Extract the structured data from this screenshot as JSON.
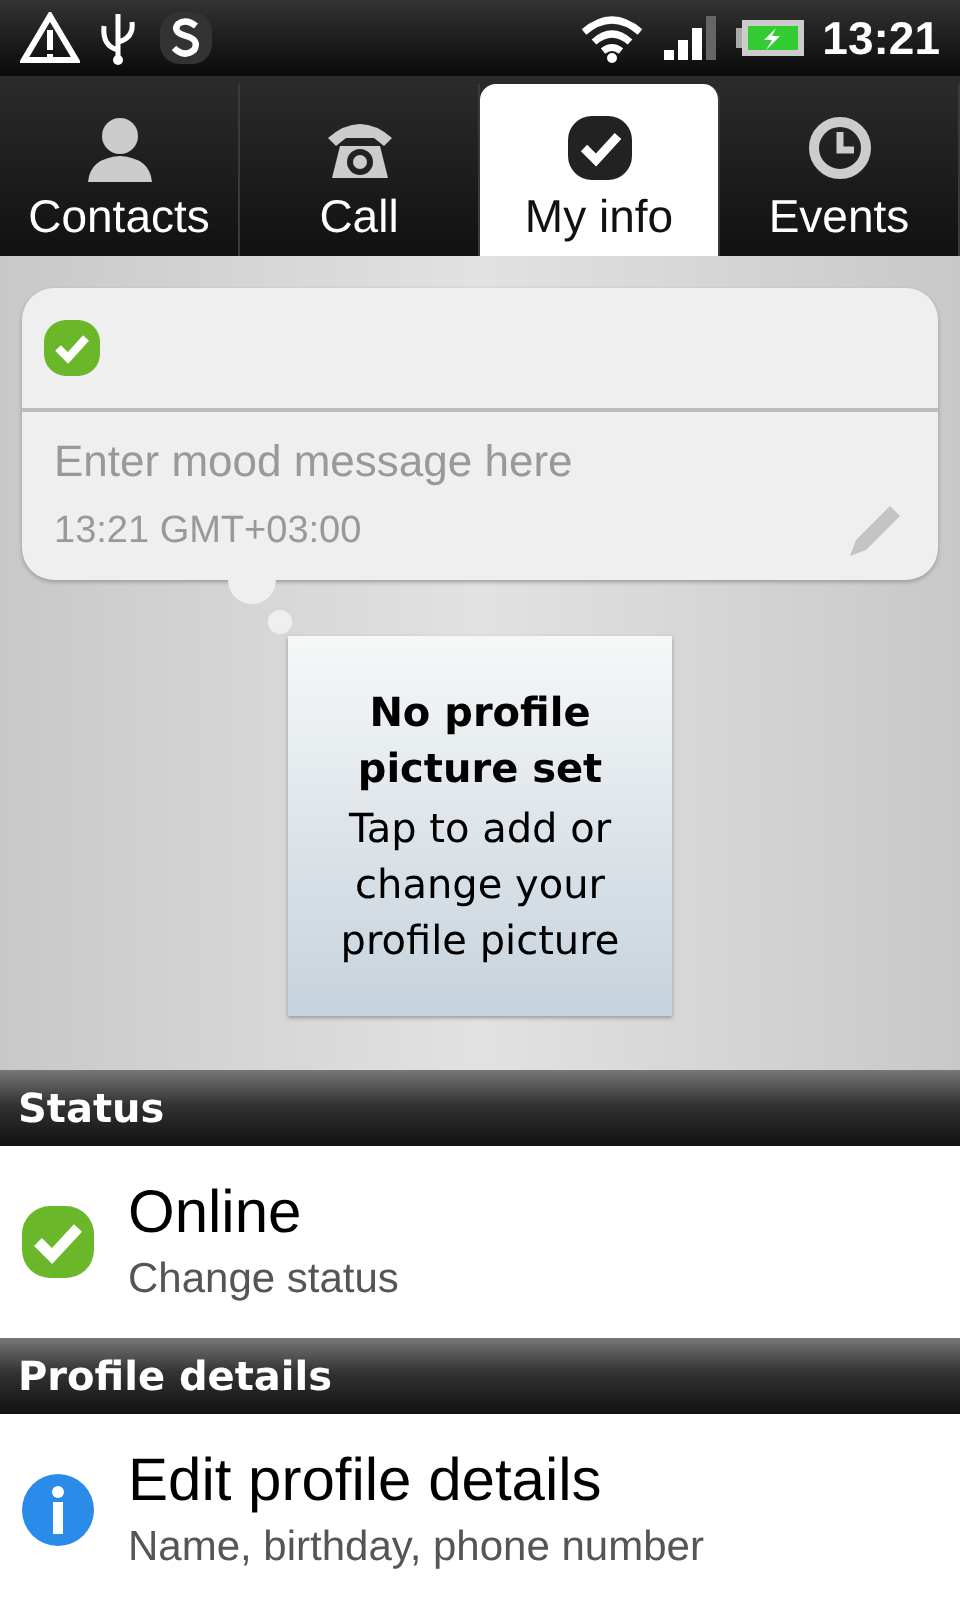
{
  "status_bar": {
    "time": "13:21"
  },
  "tabs": [
    {
      "label": "Contacts",
      "selected": false
    },
    {
      "label": "Call",
      "selected": false
    },
    {
      "label": "My info",
      "selected": true
    },
    {
      "label": "Events",
      "selected": false
    }
  ],
  "mood": {
    "placeholder": "Enter mood message here",
    "timestamp": "13:21 GMT+03:00"
  },
  "profile_picture": {
    "title": "No profile picture set",
    "hint": "Tap to add or change your profile picture"
  },
  "sections": [
    {
      "header": "Status",
      "title": "Online",
      "subtitle": "Change status"
    },
    {
      "header": "Profile details",
      "title": "Edit profile details",
      "subtitle": "Name, birthday, phone number"
    }
  ]
}
